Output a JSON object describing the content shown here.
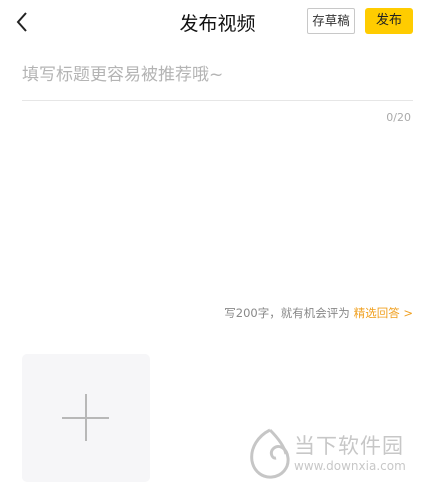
{
  "header": {
    "title": "发布视频",
    "draft_label": "存草稿",
    "publish_label": "发布",
    "back_icon": "chevron-left-icon"
  },
  "title_field": {
    "value": "",
    "placeholder": "填写标题更容易被推荐哦~",
    "counter": "0/20"
  },
  "hint": {
    "text": "写200字，就有机会评为",
    "link": "精选回答 >"
  },
  "upload": {
    "icon": "plus-icon"
  },
  "watermark": {
    "name": "当下软件园",
    "url": "www.downxia.com"
  },
  "colors": {
    "accent": "#ffcc00",
    "link": "#f0a020"
  }
}
